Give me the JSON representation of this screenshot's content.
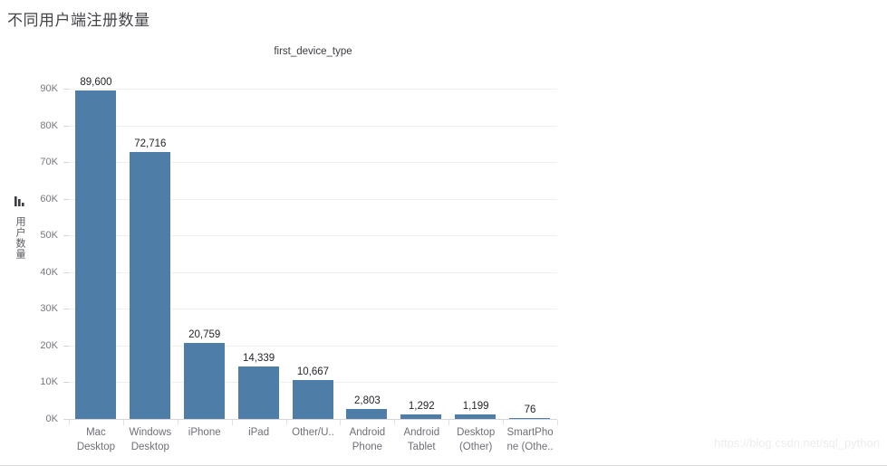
{
  "page": {
    "header_title": "不同用户端注册数量",
    "watermark": "https://blog.csdn.net/sql_python"
  },
  "axis": {
    "y_title": "用户数量",
    "y_title_icon": "bar-chart-icon"
  },
  "chart_data": {
    "type": "bar",
    "title": "first_device_type",
    "xlabel": "",
    "ylabel": "用户数量",
    "ylim": [
      0,
      90000
    ],
    "y_ticks": [
      0,
      10000,
      20000,
      30000,
      40000,
      50000,
      60000,
      70000,
      80000,
      90000
    ],
    "y_tick_labels": [
      "0K",
      "10K",
      "20K",
      "30K",
      "40K",
      "50K",
      "60K",
      "70K",
      "80K",
      "90K"
    ],
    "grid": true,
    "legend": false,
    "bar_color": "#4E7EA8",
    "categories": [
      "Mac Desktop",
      "Windows Desktop",
      "iPhone",
      "iPad",
      "Other/U..",
      "Android Phone",
      "Android Tablet",
      "Desktop (Other)",
      "SmartPhone (Othe.."
    ],
    "category_label_lines": [
      [
        "Mac",
        "Desktop"
      ],
      [
        "Windows",
        "Desktop"
      ],
      [
        "iPhone",
        ""
      ],
      [
        "iPad",
        ""
      ],
      [
        "Other/U..",
        ""
      ],
      [
        "Android",
        "Phone"
      ],
      [
        "Android",
        "Tablet"
      ],
      [
        "Desktop",
        "(Other)"
      ],
      [
        "SmartPho",
        "ne (Othe.."
      ]
    ],
    "values": [
      89600,
      72716,
      20759,
      14339,
      10667,
      2803,
      1292,
      1199,
      76
    ],
    "value_labels": [
      "89,600",
      "72,716",
      "20,759",
      "14,339",
      "10,667",
      "2,803",
      "1,292",
      "1,199",
      "76"
    ]
  }
}
